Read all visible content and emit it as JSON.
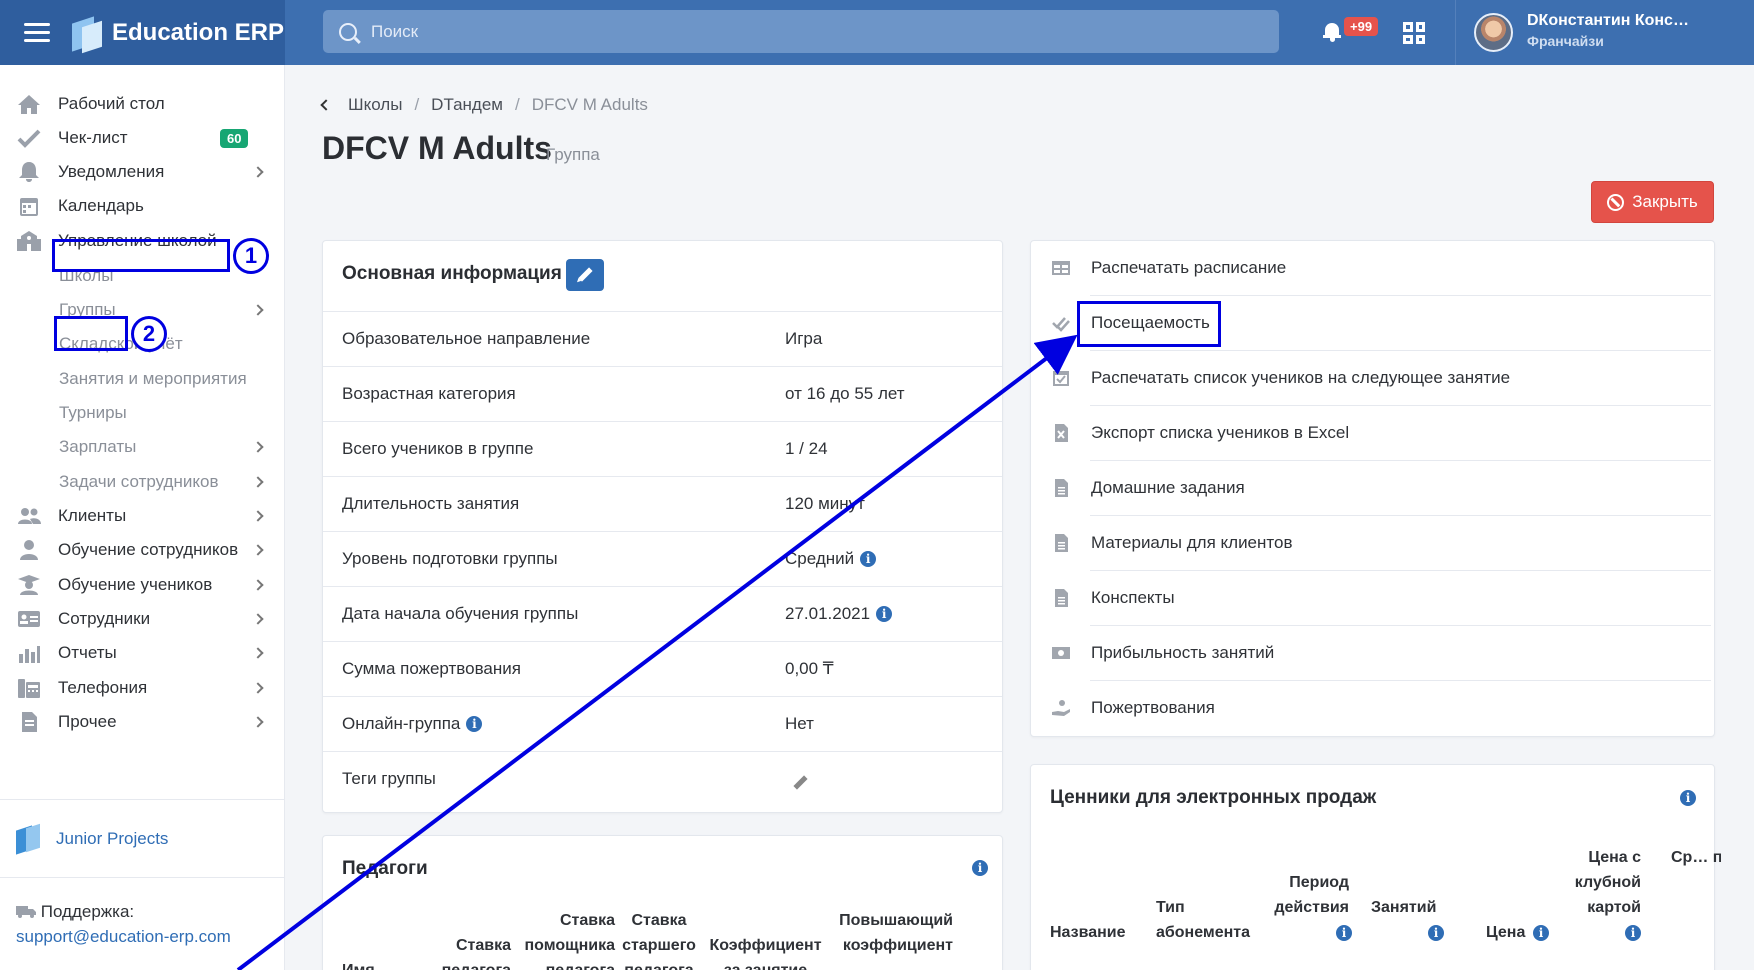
{
  "app": {
    "title": "Education ERP"
  },
  "search": {
    "placeholder": "Поиск"
  },
  "header": {
    "notif_count": "+99",
    "user_name": "DКонстантин Конс…",
    "user_role": "Франчайзи"
  },
  "sidebar": {
    "items": [
      {
        "label": "Рабочий стол",
        "icon": "home-icon"
      },
      {
        "label": "Чек-лист",
        "icon": "check-icon",
        "badge": "60"
      },
      {
        "label": "Уведомления",
        "icon": "bell-icon"
      },
      {
        "label": "Календарь",
        "icon": "calendar-icon"
      },
      {
        "label": "Управление школой",
        "icon": "school-icon"
      }
    ],
    "sub_items": [
      {
        "label": "Школы"
      },
      {
        "label": "Группы"
      },
      {
        "label": "Складской учёт"
      },
      {
        "label": "Занятия и мероприятия"
      },
      {
        "label": "Турниры"
      },
      {
        "label": "Зарплаты"
      },
      {
        "label": "Задачи сотрудников"
      }
    ],
    "bottom_items": [
      {
        "label": "Клиенты",
        "icon": "users-icon"
      },
      {
        "label": "Обучение сотрудников",
        "icon": "user-tie-icon"
      },
      {
        "label": "Обучение учеников",
        "icon": "graduate-icon"
      },
      {
        "label": "Сотрудники",
        "icon": "id-card-icon"
      },
      {
        "label": "Отчеты",
        "icon": "chart-icon"
      },
      {
        "label": "Телефония",
        "icon": "phone-icon"
      },
      {
        "label": "Прочее",
        "icon": "file-icon"
      }
    ],
    "junior": "Junior Projects",
    "support_label": "Поддержка:",
    "support_email": "support@education-erp.com"
  },
  "annotations": {
    "step1": "1",
    "step2": "2"
  },
  "breadcrumbs": [
    "Школы",
    "DТандем",
    "DFCV M Adults"
  ],
  "breadcrumb_sep": "/",
  "page": {
    "title": "DFCV M Adults",
    "subtitle": "Группа",
    "close_label": "Закрыть"
  },
  "main_info": {
    "title": "Основная информация",
    "rows": [
      {
        "label": "Образовательное направление",
        "value": "Игра"
      },
      {
        "label": "Возрастная категория",
        "value": "от 16 до 55 лет"
      },
      {
        "label": "Всего учеников в группе",
        "value": "1 / 24"
      },
      {
        "label": "Длительность занятия",
        "value": "120 минут"
      },
      {
        "label": "Уровень подготовки группы",
        "value": "Средний"
      },
      {
        "label": "Дата начала обучения группы",
        "value": "27.01.2021"
      },
      {
        "label": "Сумма пожертвования",
        "value": "0,00 ₸"
      },
      {
        "label": "Онлайн-группа",
        "value": "Нет"
      },
      {
        "label": "Теги группы",
        "value": ""
      }
    ]
  },
  "teachers": {
    "title": "Педагоги",
    "headers": [
      "Имя",
      "Ставка педагога",
      "Ставка помощника педагога",
      "Ставка старшего педагога",
      "Коэффициент за занятие",
      "Повышающий коэффициент"
    ]
  },
  "actions": [
    {
      "label": "Распечатать расписание",
      "icon": "table-icon"
    },
    {
      "label": "Посещаемость",
      "icon": "double-check-icon"
    },
    {
      "label": "Распечатать список учеников на следующее занятие",
      "icon": "calendar-check-icon"
    },
    {
      "label": "Экспорт списка учеников в Excel",
      "icon": "excel-icon"
    },
    {
      "label": "Домашние задания",
      "icon": "document-icon"
    },
    {
      "label": "Материалы для клиентов",
      "icon": "document-icon"
    },
    {
      "label": "Конспекты",
      "icon": "document-icon"
    },
    {
      "label": "Прибыльность занятий",
      "icon": "money-icon"
    },
    {
      "label": "Пожертвования",
      "icon": "donate-icon"
    }
  ],
  "prices": {
    "title": "Ценники для электронных продаж",
    "headers": [
      "Название",
      "Тип абонемента",
      "Период действия",
      "Занятий",
      "Цена",
      "Цена с клубной картой",
      "Ср… прод…"
    ]
  },
  "colors": {
    "topbar": "#3d6fb0",
    "brand": "#2f5e9e",
    "accent": "#2f6db5",
    "danger": "#e5534b",
    "success": "#17a673",
    "annotation": "#0000e0"
  }
}
